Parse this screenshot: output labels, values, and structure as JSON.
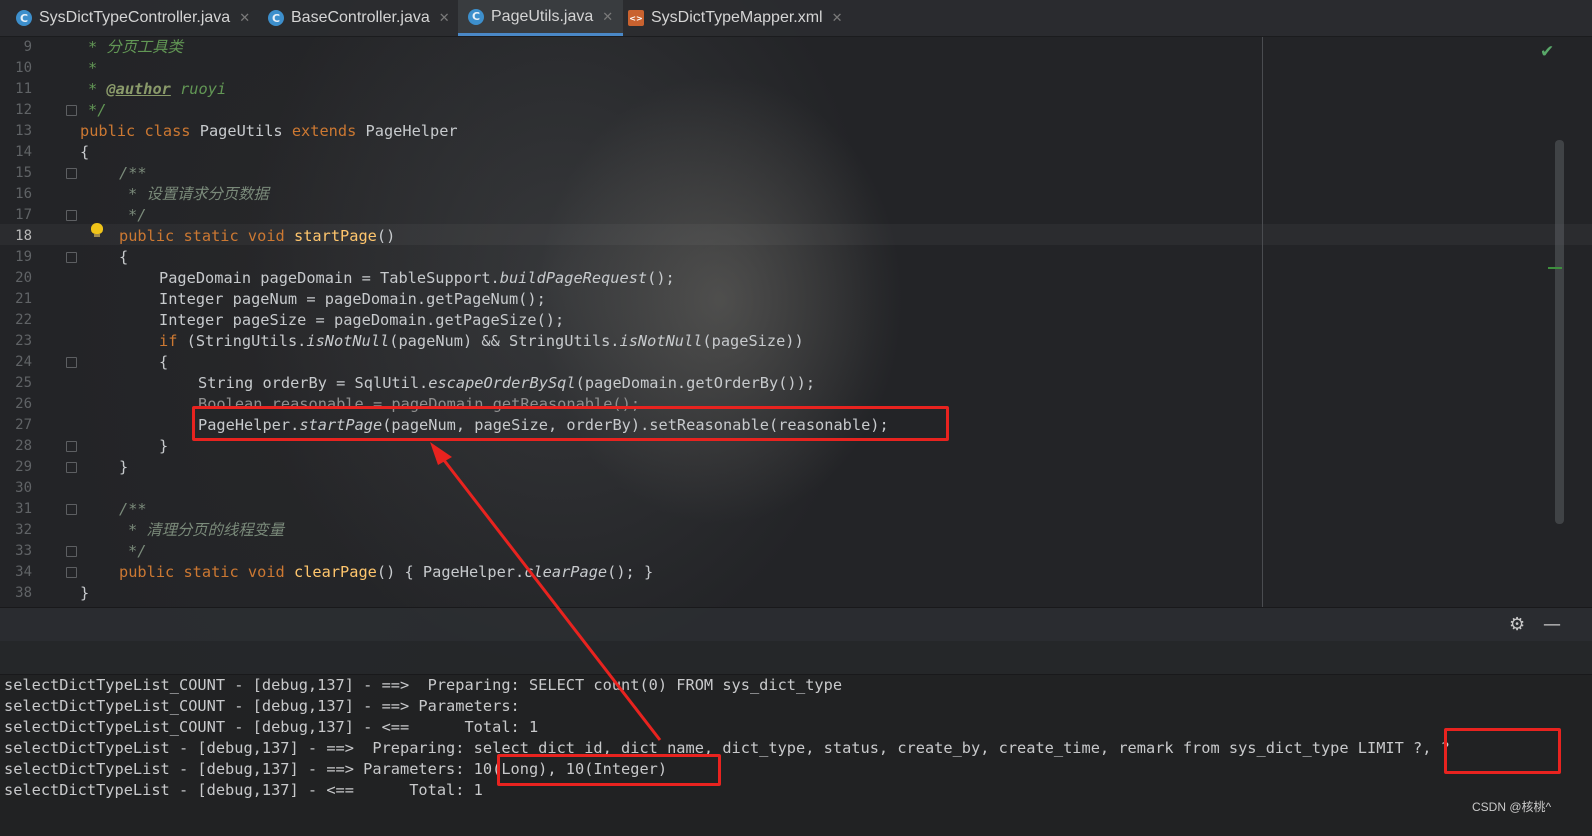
{
  "tabs": [
    {
      "label": "SysDictTypeController.java",
      "icon": "java-class-icon",
      "active": false
    },
    {
      "label": "BaseController.java",
      "icon": "java-class-icon",
      "active": false
    },
    {
      "label": "PageUtils.java",
      "icon": "java-class-icon",
      "active": true
    },
    {
      "label": "SysDictTypeMapper.xml",
      "icon": "xml-file-icon",
      "active": false
    }
  ],
  "tab_icon_letter": "C",
  "tab_close": "✕",
  "editor": {
    "current_line": "18",
    "line_numbers": [
      "9",
      "10",
      "11",
      "12",
      "13",
      "14",
      "15",
      "16",
      "17",
      "18",
      "19",
      "20",
      "21",
      "22",
      "23",
      "24",
      "25",
      "26",
      "27",
      "28",
      "29",
      "30",
      "31",
      "32",
      "33",
      "34",
      "38"
    ],
    "lines": {
      "l9": "* 分页工具类",
      "l10": "*",
      "l11_star": "* ",
      "l11_tag": "@author",
      "l11_name": " ruoyi",
      "l12": "*/",
      "l13_kw": "public class ",
      "l13_name": "PageUtils ",
      "l13_kw2": "extends ",
      "l13_base": "PageHelper",
      "l14": "{",
      "l15": "/**",
      "l16": "* 设置请求分页数据",
      "l17": "*/",
      "l18_kw": "public static void ",
      "l18_fn": "startPage",
      "l18_end": "()",
      "l19": "{",
      "l20_a": "PageDomain pageDomain = TableSupport.",
      "l20_b": "buildPageRequest",
      "l20_c": "();",
      "l21": "Integer pageNum = pageDomain.getPageNum();",
      "l22": "Integer pageSize = pageDomain.getPageSize();",
      "l23_kw": "if ",
      "l23_a": "(StringUtils.",
      "l23_b": "isNotNull",
      "l23_c": "(pageNum) && StringUtils.",
      "l23_d": "isNotNull",
      "l23_e": "(pageSize))",
      "l24": "{",
      "l25_a": "String orderBy = SqlUtil.",
      "l25_b": "escapeOrderBySql",
      "l25_c": "(pageDomain.getOrderBy());",
      "l26": "Boolean reasonable = pageDomain.getReasonable();",
      "l27_a": "PageHelper.",
      "l27_b": "startPage",
      "l27_c": "(pageNum, pageSize, orderBy).setReasonable(reasonable);",
      "l28": "}",
      "l29": "}",
      "l31": "/**",
      "l32": "* 清理分页的线程变量",
      "l33": "*/",
      "l34_kw": "public static void ",
      "l34_fn": "clearPage",
      "l34_a": "() { PageHelper.",
      "l34_b": "clearPage",
      "l34_c": "(); }",
      "l38": "}"
    }
  },
  "console": {
    "gear": "⚙",
    "minimize": "—",
    "lines": [
      "selectDictTypeList_COUNT - [debug,137] - ==>  Preparing: SELECT count(0) FROM sys_dict_type",
      "selectDictTypeList_COUNT - [debug,137] - ==> Parameters: ",
      "selectDictTypeList_COUNT - [debug,137] - <==      Total: 1",
      "selectDictTypeList - [debug,137] - ==>  Preparing: select dict_id, dict_name, dict_type, status, create_by, create_time, remark from sys_dict_type LIMIT ?, ?",
      "selectDictTypeList - [debug,137] - ==> Parameters: 10(Long), 10(Integer)",
      "selectDictTypeList - [debug,137] - <==      Total: 1"
    ]
  },
  "watermark": "CSDN @核桃^"
}
